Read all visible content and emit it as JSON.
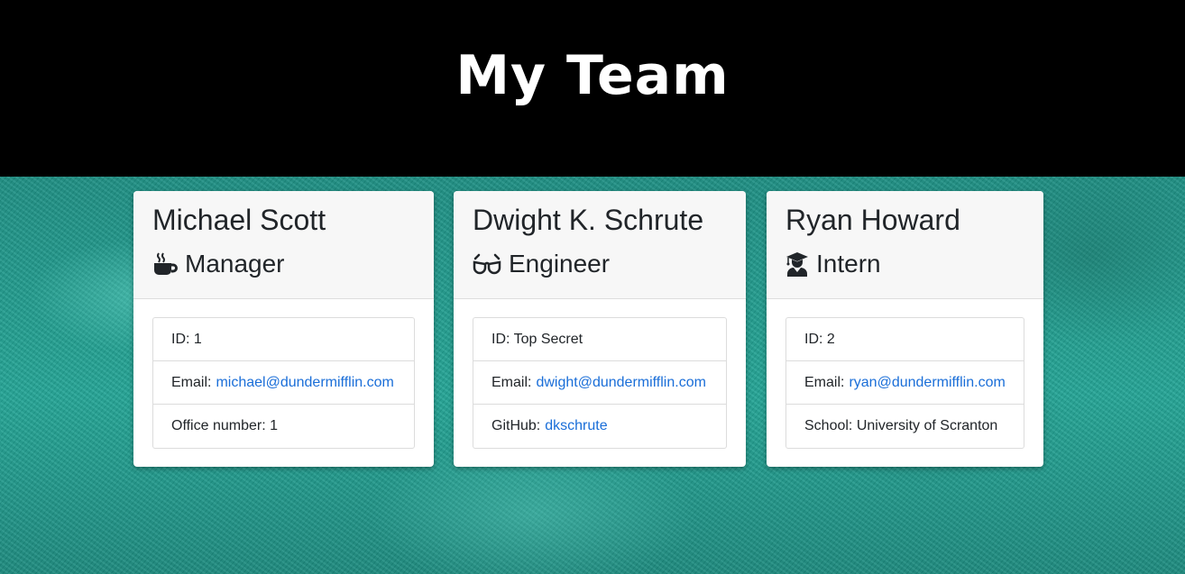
{
  "header": {
    "title": "My Team"
  },
  "cards": [
    {
      "name": "Michael Scott",
      "role": "Manager",
      "icon": "mug-icon",
      "id_text": "ID: 1",
      "email_label": "Email:",
      "email": "michael@dundermifflin.com",
      "extra_label": "Office number: 1"
    },
    {
      "name": "Dwight K. Schrute",
      "role": "Engineer",
      "icon": "glasses-icon",
      "id_text": "ID: Top Secret",
      "email_label": "Email:",
      "email": "dwight@dundermifflin.com",
      "extra_label": "GitHub:",
      "extra_link": "dkschrute"
    },
    {
      "name": "Ryan Howard",
      "role": "Intern",
      "icon": "graduate-icon",
      "id_text": "ID: 2",
      "email_label": "Email:",
      "email": "ryan@dundermifflin.com",
      "extra_label": "School: University of Scranton"
    }
  ],
  "colors": {
    "header_bg": "#000000",
    "link": "#1a6ed8",
    "card_head_bg": "#f7f7f7",
    "backdrop": "#1e9a8c"
  }
}
